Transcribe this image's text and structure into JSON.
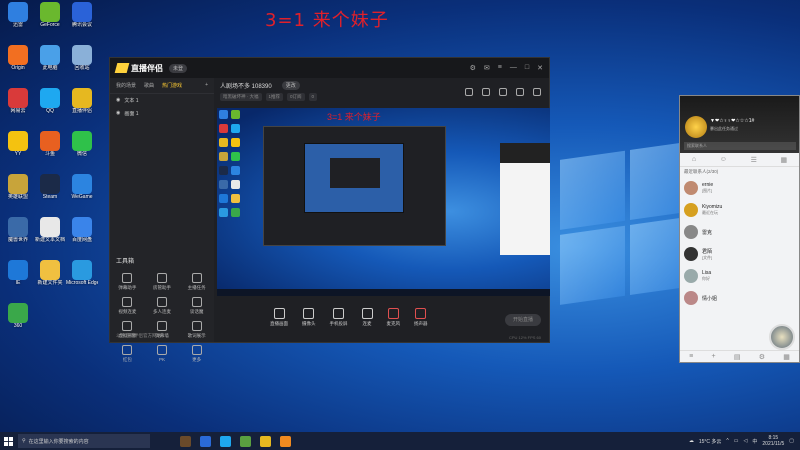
{
  "overlay_title": "3=1 来个妹子",
  "desktop_icons": [
    {
      "label": "迅雷",
      "color": "#2f7fe0"
    },
    {
      "label": "GeForce",
      "color": "#6ab82e"
    },
    {
      "label": "腾讯会议",
      "color": "#2a62d8"
    },
    {
      "label": "Origin",
      "color": "#f26f21"
    },
    {
      "label": "此电脑",
      "color": "#4aa0e8"
    },
    {
      "label": "回收站",
      "color": "#8ab0d8"
    },
    {
      "label": "网易云",
      "color": "#d93a3a"
    },
    {
      "label": "QQ",
      "color": "#1ea8f0"
    },
    {
      "label": "直播伴侣",
      "color": "#e6b820"
    },
    {
      "label": "YY",
      "color": "#f4c210"
    },
    {
      "label": "斗鱼",
      "color": "#e86020"
    },
    {
      "label": "微信",
      "color": "#2fc14a"
    },
    {
      "label": "英雄联盟",
      "color": "#c8a43a"
    },
    {
      "label": "Steam",
      "color": "#1b2a48"
    },
    {
      "label": "WeGame",
      "color": "#2c84e0"
    },
    {
      "label": "魔兽世界",
      "color": "#3a6aa8"
    },
    {
      "label": "新建文本文档",
      "color": "#e8e8e8"
    },
    {
      "label": "百度网盘",
      "color": "#3a84ea"
    },
    {
      "label": "IE",
      "color": "#1e78d8"
    },
    {
      "label": "新建文件夹",
      "color": "#f0c040"
    },
    {
      "label": "Microsoft Edge",
      "color": "#2a9ae0"
    },
    {
      "label": "360",
      "color": "#3aa84a"
    }
  ],
  "app": {
    "logo": "直播伴侣",
    "badge": "未登",
    "left_tabs": [
      "我的场景",
      "歌曲",
      "热门游戏"
    ],
    "scene_items": [
      "文本 1",
      "画面 1"
    ],
    "tools_title": "工具箱",
    "tools": [
      "弹幕助手",
      "房管助手",
      "主播任务",
      "视频连麦",
      "多人连麦",
      "谈话魔",
      "虚拟形象",
      "弹幕墙",
      "歌词展示",
      "红包",
      "PK",
      "更多"
    ],
    "bottom_note": "斗鱼直播伴侣官方网站",
    "room_title": "人剧场不多 108390",
    "room_tag": "更改",
    "room_meta": [
      "暗黑破坏神 · 大福",
      "1推荐",
      "0订阅",
      "0"
    ],
    "controls": [
      "直播画面",
      "摄像头",
      "手机投屏",
      "连麦",
      "麦克风",
      "扬声器"
    ],
    "start_btn": "开始直播",
    "status_text": "CPU 12% FPS 60"
  },
  "preview_title": "3=1 来个妹子",
  "chat": {
    "name": "▼❤☆♀♀❤☆☆☆1#",
    "sign": "暴出此任务通过",
    "search": "搜索联系人",
    "section": "最近联系人(2/30)",
    "contacts": [
      {
        "name": "ernie",
        "msg": "[图片]",
        "color": "#c08a70"
      },
      {
        "name": "Kiyomizu",
        "msg": "最近在玩",
        "color": "#d6a020"
      },
      {
        "name": "雷克",
        "msg": "",
        "color": "#888"
      },
      {
        "name": "君陌",
        "msg": "[文件]",
        "color": "#333"
      },
      {
        "name": "Lisa",
        "msg": "你好",
        "color": "#9aa"
      },
      {
        "name": "情小姐",
        "msg": "",
        "color": "#b88"
      }
    ]
  },
  "taskbar": {
    "search_placeholder": "在这里输入你要搜索的内容",
    "weather": "15°C 多云",
    "lang": "中",
    "time": "8:15",
    "date": "2021/11/5",
    "apps": [
      "#6a4a2a",
      "#2a6ad8",
      "#1ea8f0",
      "#5aa040",
      "#e6b820",
      "#f08a20"
    ]
  }
}
